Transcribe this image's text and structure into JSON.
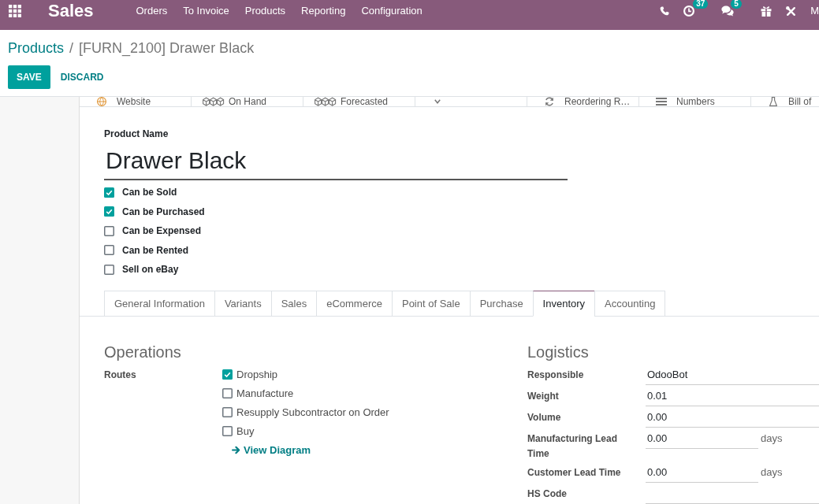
{
  "top_bar": {
    "app_title": "Sales",
    "menu": [
      "Orders",
      "To Invoice",
      "Products",
      "Reporting",
      "Configuration"
    ],
    "systray": [
      {
        "kind": "phone"
      },
      {
        "kind": "clock",
        "badge": "37"
      },
      {
        "kind": "chat",
        "badge": "5"
      },
      {
        "kind": "gift"
      },
      {
        "kind": "tools"
      }
    ],
    "user": "M"
  },
  "breadcrumb": {
    "parent": "Products",
    "separator": "/",
    "current": "[FURN_2100] Drawer Black"
  },
  "actions": {
    "save": "SAVE",
    "discard": "DISCARD"
  },
  "stat_buttons": [
    {
      "kind": "globe",
      "label": "Website"
    },
    {
      "kind": "cubes",
      "label": "On Hand"
    },
    {
      "kind": "cubes",
      "label": "Forecasted"
    },
    {
      "kind": "caret"
    },
    {
      "kind": "refresh",
      "label": "Reordering R…"
    },
    {
      "kind": "bars",
      "label": "Numbers"
    },
    {
      "kind": "flask",
      "label": "Bill of"
    }
  ],
  "product": {
    "name_label": "Product Name",
    "name": "Drawer Black",
    "flags": [
      {
        "label": "Can be Sold",
        "checked": true
      },
      {
        "label": "Can be Purchased",
        "checked": true
      },
      {
        "label": "Can be Expensed",
        "checked": false
      },
      {
        "label": "Can be Rented",
        "checked": false
      },
      {
        "label": "Sell on eBay",
        "checked": false
      }
    ]
  },
  "tabs": [
    {
      "label": "General Information",
      "selected": false
    },
    {
      "label": "Variants",
      "selected": false
    },
    {
      "label": "Sales",
      "selected": false
    },
    {
      "label": "eCommerce",
      "selected": false
    },
    {
      "label": "Point of Sale",
      "selected": false
    },
    {
      "label": "Purchase",
      "selected": false
    },
    {
      "label": "Inventory",
      "selected": true
    },
    {
      "label": "Accounting",
      "selected": false
    }
  ],
  "operations": {
    "title": "Operations",
    "routes_label": "Routes",
    "routes": [
      {
        "label": "Dropship",
        "checked": true
      },
      {
        "label": "Manufacture",
        "checked": false
      },
      {
        "label": "Resupply Subcontractor on Order",
        "checked": false
      },
      {
        "label": "Buy",
        "checked": false
      }
    ],
    "diagram_link": "View Diagram"
  },
  "logistics": {
    "title": "Logistics",
    "fields": [
      {
        "label": "Responsible",
        "value": "OdooBot"
      },
      {
        "label": "Weight",
        "value": "0.01"
      },
      {
        "label": "Volume",
        "value": "0.00"
      },
      {
        "label": "Manufacturing Lead Time",
        "value": "0.00",
        "unit": "days"
      },
      {
        "label": "Customer Lead Time",
        "value": "0.00",
        "unit": "days"
      },
      {
        "label": "HS Code"
      }
    ]
  }
}
